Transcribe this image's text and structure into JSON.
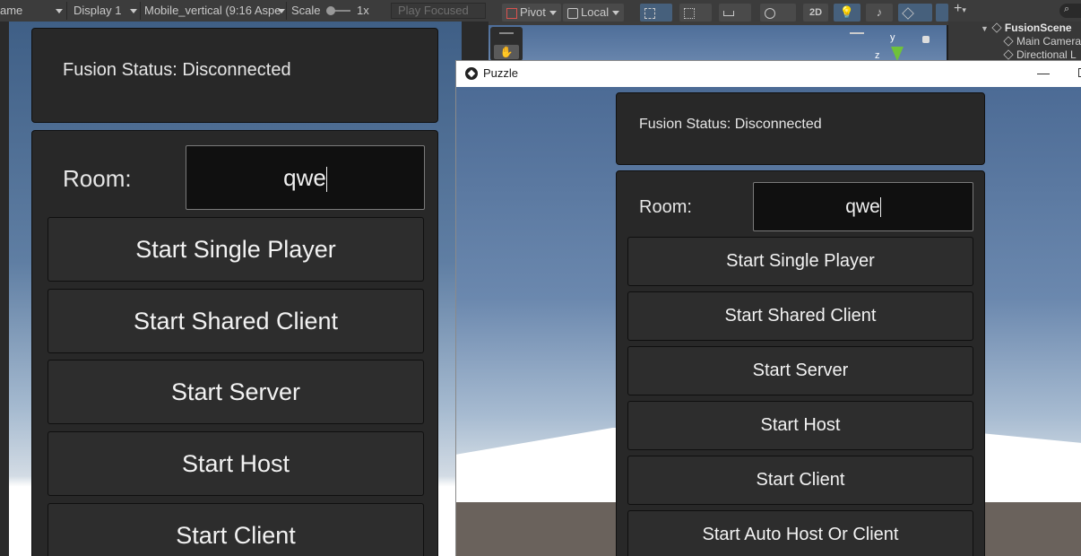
{
  "game_toolbar": {
    "game_tab_label": "ame",
    "display": "Display 1",
    "aspect": "Mobile_vertical (9:16 Aspe",
    "scale_label": "Scale",
    "scale_value": "1x",
    "play_mode": "Play Focused"
  },
  "scene_toolbar": {
    "pivot": "Pivot",
    "space": "Local",
    "mode_2d": "2D",
    "gizmo_axis_y": "y",
    "gizmo_axis_z": "z"
  },
  "hierarchy": {
    "add_label": "+",
    "scene": "FusionScene",
    "items": [
      "Main Camera",
      "Directional L"
    ]
  },
  "left_ui": {
    "status": "Fusion Status: Disconnected",
    "room_label": "Room:",
    "room_value": "qwe",
    "buttons": [
      "Start Single Player",
      "Start Shared Client",
      "Start Server",
      "Start Host",
      "Start Client"
    ]
  },
  "puzzle_window": {
    "title": "Puzzle",
    "minimize": "—",
    "status": "Fusion Status: Disconnected",
    "room_label": "Room:",
    "room_value": "qwe",
    "buttons": [
      "Start Single Player",
      "Start Shared Client",
      "Start Server",
      "Start Host",
      "Start Client",
      "Start Auto Host Or Client"
    ]
  },
  "colors": {
    "panel_bg": "#282828",
    "button_bg": "#2d2d2d",
    "input_bg": "#101010",
    "editor_toolbar": "#3c3c3c",
    "sky_top": "#3f5f86"
  }
}
